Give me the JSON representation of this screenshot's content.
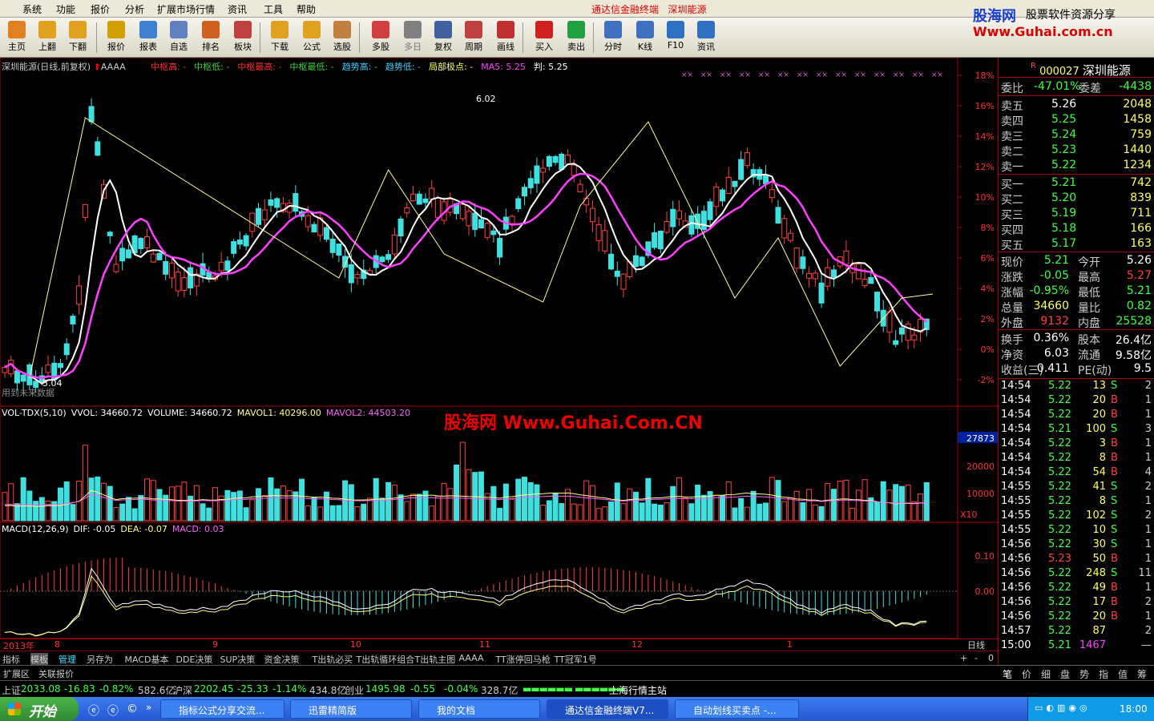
{
  "menu": {
    "items": [
      "系统",
      "功能",
      "报价",
      "分析",
      "扩展市场行情",
      "资讯",
      "工具",
      "帮助"
    ],
    "app_title": "通达信金融终端",
    "stock_title": "深圳能源"
  },
  "brand": {
    "name": "股海网",
    "slogan": "股票软件资源分享",
    "url": "Www.Guhai.com.cn"
  },
  "toolbar": {
    "buttons": [
      "主页",
      "上翻",
      "下翻",
      "报价",
      "报表",
      "自选",
      "排名",
      "板块",
      "下载",
      "公式",
      "选股",
      "多股",
      "多日",
      "复权",
      "周期",
      "画线",
      "买入",
      "卖出",
      "分时",
      "K线",
      "F10",
      "资讯"
    ]
  },
  "chart": {
    "title": "深圳能源(日线,前复权)",
    "formula": "AAAA",
    "legend": [
      {
        "t": "中枢高: -",
        "c": "#ff3030"
      },
      {
        "t": "中枢低: -",
        "c": "#40d040"
      },
      {
        "t": "中枢最高: -",
        "c": "#ff3030"
      },
      {
        "t": "中枢最低: -",
        "c": "#40d040"
      },
      {
        "t": "趋势高: -",
        "c": "#40d0ff"
      },
      {
        "t": "趋势低: -",
        "c": "#40d0ff"
      },
      {
        "t": "局部极点: -",
        "c": "#ffff60"
      },
      {
        "t": "MA5: 5.25",
        "c": "#ff40ff"
      },
      {
        "t": "判: 5.25",
        "c": "#ffffff"
      }
    ],
    "high_label": "6.02",
    "low_label": "5.04",
    "future_note": "用到未来数据",
    "watermark": "股海网 Www.Guhai.Com.CN",
    "pct_axis": [
      "18%",
      "16%",
      "14%",
      "12%",
      "10%",
      "8%",
      "6%",
      "4%",
      "2%",
      "0%",
      "-2%"
    ],
    "vol_legend": [
      {
        "t": "VOL-TDX(5,10)",
        "c": "#ffffff"
      },
      {
        "t": "VVOL: 34660.72",
        "c": "#ffffff"
      },
      {
        "t": "VOLUME: 34660.72",
        "c": "#ffffff"
      },
      {
        "t": "MAVOL1: 40296.00",
        "c": "#ffff80"
      },
      {
        "t": "MAVOL2: 44503.20",
        "c": "#ff60ff"
      }
    ],
    "vol_axis": [
      "27873",
      "20000",
      "10000",
      "X10"
    ],
    "macd_legend": [
      {
        "t": "MACD(12,26,9)",
        "c": "#ffffff"
      },
      {
        "t": "DIF: -0.05",
        "c": "#ffffff"
      },
      {
        "t": "DEA: -0.07",
        "c": "#ffff80"
      },
      {
        "t": "MACD: 0.03",
        "c": "#ff60ff"
      }
    ],
    "macd_axis": [
      "0.10",
      "0.00"
    ],
    "date_axis": [
      "2013年",
      "8",
      "9",
      "10",
      "11",
      "12",
      "1"
    ],
    "period": "日线"
  },
  "chart_data": {
    "type": "candlestick",
    "xlabel": "",
    "ylabel": "",
    "high": 6.02,
    "low": 5.04,
    "ma5": 5.25
  },
  "bottom_tabs": [
    "指标",
    "模板",
    "管理",
    "另存为",
    "MACD基本",
    "DDE决策",
    "SUP决策",
    "资金决策",
    "T出轨必买",
    "T出轨循环组合",
    "T出轨主图",
    "AAAA",
    "TT涨停回马枪",
    "TT冠军1号"
  ],
  "bottom_controls": [
    "+",
    "-",
    "0"
  ],
  "ext_tabs": [
    "扩展区",
    "关联报价"
  ],
  "quote": {
    "code": "000027",
    "name": "深圳能源",
    "weibi": {
      "label": "委比",
      "value": "-47.01%",
      "label2": "委差",
      "value2": "-4438"
    },
    "sells": [
      {
        "l": "卖五",
        "p": "5.26",
        "v": "2048",
        "c": "#ffffff"
      },
      {
        "l": "卖四",
        "p": "5.25",
        "v": "1458",
        "c": "#40ff40"
      },
      {
        "l": "卖三",
        "p": "5.24",
        "v": "759",
        "c": "#40ff40"
      },
      {
        "l": "卖二",
        "p": "5.23",
        "v": "1440",
        "c": "#40ff40"
      },
      {
        "l": "卖一",
        "p": "5.22",
        "v": "1234",
        "c": "#40ff40"
      }
    ],
    "buys": [
      {
        "l": "买一",
        "p": "5.21",
        "v": "742",
        "c": "#40ff40"
      },
      {
        "l": "买二",
        "p": "5.20",
        "v": "839",
        "c": "#40ff40"
      },
      {
        "l": "买三",
        "p": "5.19",
        "v": "711",
        "c": "#40ff40"
      },
      {
        "l": "买四",
        "p": "5.18",
        "v": "166",
        "c": "#40ff40"
      },
      {
        "l": "买五",
        "p": "5.17",
        "v": "163",
        "c": "#40ff40"
      }
    ],
    "stats": [
      {
        "l1": "现价",
        "v1": "5.21",
        "c1": "#40ff40",
        "l2": "今开",
        "v2": "5.26",
        "c2": "#ffffff"
      },
      {
        "l1": "涨跌",
        "v1": "-0.05",
        "c1": "#40ff40",
        "l2": "最高",
        "v2": "5.27",
        "c2": "#ff4040"
      },
      {
        "l1": "涨幅",
        "v1": "-0.95%",
        "c1": "#40ff40",
        "l2": "最低",
        "v2": "5.21",
        "c2": "#40ff40"
      },
      {
        "l1": "总量",
        "v1": "34660",
        "c1": "#ffff60",
        "l2": "量比",
        "v2": "0.82",
        "c2": "#40ff40"
      },
      {
        "l1": "外盘",
        "v1": "9132",
        "c1": "#ff4040",
        "l2": "内盘",
        "v2": "25528",
        "c2": "#40ff40"
      },
      {
        "l1": "换手",
        "v1": "0.36%",
        "c1": "#ffffff",
        "l2": "股本",
        "v2": "26.4亿",
        "c2": "#ffffff"
      },
      {
        "l1": "净资",
        "v1": "6.03",
        "c1": "#ffffff",
        "l2": "流通",
        "v2": "9.58亿",
        "c2": "#ffffff"
      },
      {
        "l1": "收益(三)",
        "v1": "0.411",
        "c1": "#ffffff",
        "l2": "PE(动)",
        "v2": "9.5",
        "c2": "#ffffff"
      }
    ],
    "ticks": [
      [
        "14:54",
        "5.22",
        "13",
        "S",
        "2"
      ],
      [
        "14:54",
        "5.22",
        "20",
        "B",
        "1"
      ],
      [
        "14:54",
        "5.22",
        "20",
        "B",
        "1"
      ],
      [
        "14:54",
        "5.21",
        "100",
        "S",
        "3"
      ],
      [
        "14:54",
        "5.22",
        "3",
        "B",
        "1"
      ],
      [
        "14:54",
        "5.22",
        "8",
        "B",
        "1"
      ],
      [
        "14:54",
        "5.22",
        "54",
        "B",
        "4"
      ],
      [
        "14:55",
        "5.22",
        "41",
        "S",
        "2"
      ],
      [
        "14:55",
        "5.22",
        "8",
        "S",
        "1"
      ],
      [
        "14:55",
        "5.22",
        "102",
        "S",
        "2"
      ],
      [
        "14:55",
        "5.22",
        "10",
        "S",
        "1"
      ],
      [
        "14:56",
        "5.22",
        "30",
        "S",
        "1"
      ],
      [
        "14:56",
        "5.23",
        "50",
        "B",
        "1"
      ],
      [
        "14:56",
        "5.22",
        "248",
        "S",
        "11"
      ],
      [
        "14:56",
        "5.22",
        "49",
        "B",
        "1"
      ],
      [
        "14:56",
        "5.22",
        "17",
        "B",
        "2"
      ],
      [
        "14:56",
        "5.22",
        "20",
        "B",
        "1"
      ],
      [
        "14:57",
        "5.22",
        "87",
        "",
        "2"
      ],
      [
        "15:00",
        "5.21",
        "1467",
        "",
        "—"
      ]
    ],
    "tabs": [
      "笔",
      "价",
      "细",
      "盘",
      "势",
      "指",
      "值",
      "筹"
    ]
  },
  "status": {
    "sh": {
      "label": "上证",
      "v": "2033.08",
      "ch": "-16.83",
      "pct": "-0.82%",
      "amt": "582.6亿"
    },
    "hs": {
      "label": "沪深",
      "v": "2202.45",
      "ch": "-25.33",
      "pct": "-1.14%",
      "amt": "434.8亿"
    },
    "cy": {
      "label": "创业",
      "v": "1495.98",
      "ch": "-0.55",
      "pct": "-0.04%",
      "amt": "328.7亿"
    },
    "station": "上海行情主站"
  },
  "taskbar": {
    "start": "开始",
    "tasks": [
      "指标公式分享交流...",
      "迅雷精简版",
      "我的文档",
      "通达信金融终端V7...",
      "自动划线买卖点 -..."
    ],
    "time": "18:00"
  }
}
